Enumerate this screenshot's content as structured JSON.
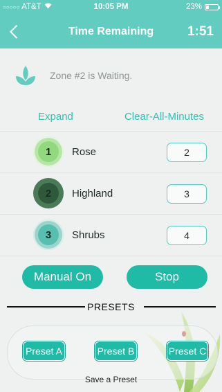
{
  "status_bar": {
    "carrier": "AT&T",
    "time": "10:05 PM",
    "battery": "23%"
  },
  "nav": {
    "title": "Time Remaining",
    "timer": "1:51"
  },
  "zone_status": {
    "text": "Zone #2 is Waiting."
  },
  "actions": {
    "expand": "Expand",
    "clear_all": "Clear-All-Minutes"
  },
  "zones": [
    {
      "number": "1",
      "name": "Rose",
      "minutes": "2",
      "ring_color": "#b6e6a6",
      "fill_color": "#92d87f"
    },
    {
      "number": "2",
      "name": "Highland",
      "minutes": "3",
      "ring_color": "#4b7a58",
      "fill_color": "#2e5a3b"
    },
    {
      "number": "3",
      "name": "Shrubs",
      "minutes": "4",
      "ring_color": "#9bd4cc",
      "fill_color": "#57bfb0"
    }
  ],
  "controls": {
    "manual_on": "Manual On",
    "stop": "Stop"
  },
  "presets": {
    "label": "PRESETS",
    "a": "Preset A",
    "b": "Preset B",
    "c": "Preset C",
    "save": "Save a Preset"
  },
  "colors": {
    "header": "#62ccc0",
    "accent": "#1fbba6",
    "link": "#33c0ae"
  }
}
